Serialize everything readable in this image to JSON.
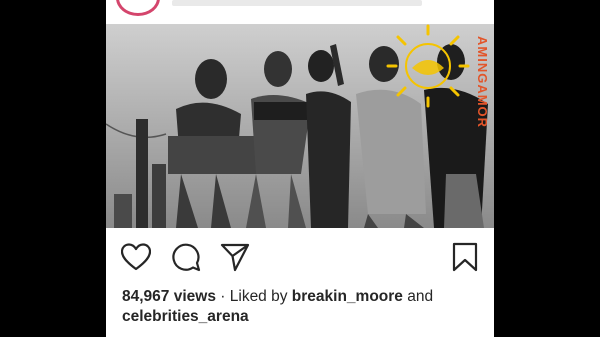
{
  "post": {
    "views_count": "84,967 views",
    "separator": "·",
    "liked_by_prefix": "Liked by",
    "liked_by_user": "breakin_moore",
    "and_word": "and",
    "liked_by_other": "celebrities_arena"
  },
  "watermark": {
    "text": "AMINGAMOR"
  },
  "icons": {
    "like": "heart-icon",
    "comment": "comment-bubble-icon",
    "share": "paper-plane-icon",
    "save": "bookmark-icon"
  },
  "colors": {
    "page_background": "#000000",
    "post_background": "#ffffff",
    "text": "#262626",
    "avatar_ring": "#d4456c",
    "watermark_sun": "#f5c400",
    "watermark_text": "#e2552a"
  }
}
